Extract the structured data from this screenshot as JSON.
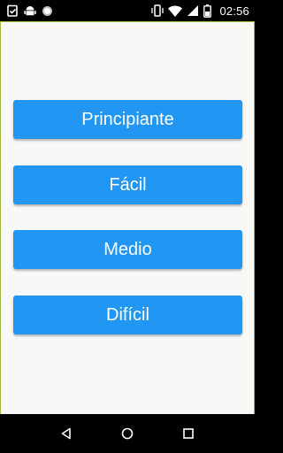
{
  "status_bar": {
    "time": "02:56",
    "left_icons": [
      "clipboard-check-icon",
      "android-icon",
      "circle-icon"
    ],
    "right_icons": [
      "vibrate-icon",
      "wifi-icon",
      "signal-icon",
      "battery-icon"
    ]
  },
  "levels": {
    "beginner": "Principiante",
    "easy": "Fácil",
    "medium": "Medio",
    "hard": "Difícil"
  },
  "nav_bar": {
    "icons": [
      "back-icon",
      "home-icon",
      "recents-icon"
    ]
  },
  "colors": {
    "accent": "#2196f3",
    "background": "#f8f8f8",
    "frame_border": "#9bbf3a"
  }
}
